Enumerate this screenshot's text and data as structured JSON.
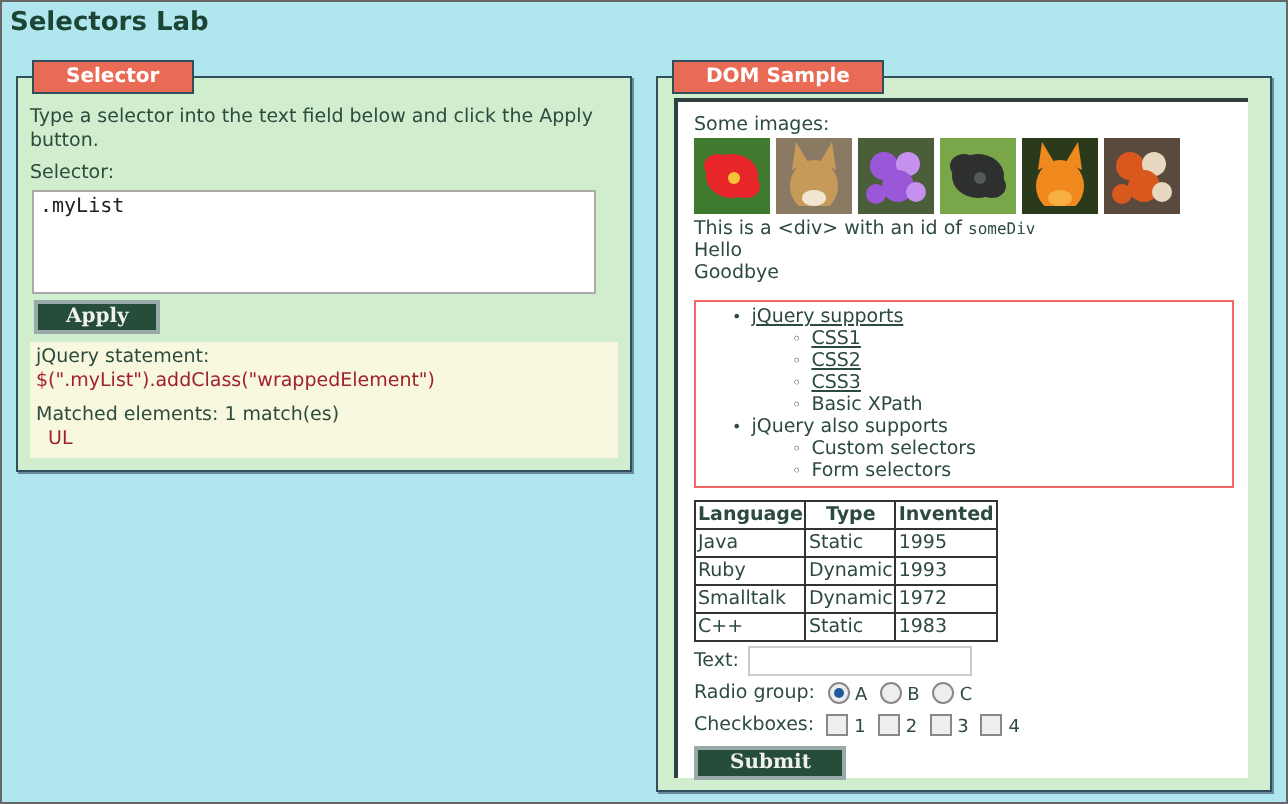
{
  "page_title": "Selectors Lab",
  "selector_panel": {
    "legend": "Selector",
    "instructions": "Type a selector into the text field below and click the Apply button.",
    "field_label": "Selector:",
    "field_value": ".myList",
    "apply_button": "Apply",
    "result": {
      "statement_label": "jQuery statement:",
      "statement": "$(\".myList\").addClass(\"wrappedElement\")",
      "matched": "Matched elements: 1 match(es)",
      "elements": [
        "UL"
      ]
    }
  },
  "dom_panel": {
    "legend": "DOM Sample",
    "images_label": "Some images:",
    "images": [
      {
        "kind": "picture"
      },
      {
        "kind": "picture"
      },
      {
        "kind": "picture"
      },
      {
        "kind": "picture"
      },
      {
        "kind": "picture"
      },
      {
        "kind": "picture"
      }
    ],
    "div_text": "This is a <div> with an id of",
    "div_id": "someDiv",
    "lines": [
      "Hello",
      "Goodbye"
    ],
    "list": [
      {
        "marker": "•",
        "text": "jQuery supports",
        "link": true,
        "children": [
          {
            "marker": "◦",
            "text": "CSS1",
            "link": true
          },
          {
            "marker": "◦",
            "text": "CSS2",
            "link": true
          },
          {
            "marker": "◦",
            "text": "CSS3",
            "link": true
          },
          {
            "marker": "◦",
            "text": "Basic XPath",
            "link": false
          }
        ]
      },
      {
        "marker": "•",
        "text": "jQuery also supports",
        "link": false,
        "children": [
          {
            "marker": "◦",
            "text": "Custom selectors",
            "link": false
          },
          {
            "marker": "◦",
            "text": "Form selectors",
            "link": false
          }
        ]
      }
    ],
    "table": {
      "columns": [
        "Language",
        "Type",
        "Invented"
      ],
      "rows": [
        [
          "Java",
          "Static",
          "1995"
        ],
        [
          "Ruby",
          "Dynamic",
          "1993"
        ],
        [
          "Smalltalk",
          "Dynamic",
          "1972"
        ],
        [
          "C++",
          "Static",
          "1983"
        ]
      ]
    },
    "text_label": "Text:",
    "radio_label": "Radio group:",
    "radios": [
      {
        "label": "A",
        "selected": true
      },
      {
        "label": "B",
        "selected": false
      },
      {
        "label": "C",
        "selected": false
      }
    ],
    "checkbox_label": "Checkboxes:",
    "checkboxes": [
      {
        "label": "1",
        "checked": false
      },
      {
        "label": "2",
        "checked": false
      },
      {
        "label": "3",
        "checked": false
      },
      {
        "label": "4",
        "checked": false
      }
    ],
    "submit_button": "Submit"
  }
}
